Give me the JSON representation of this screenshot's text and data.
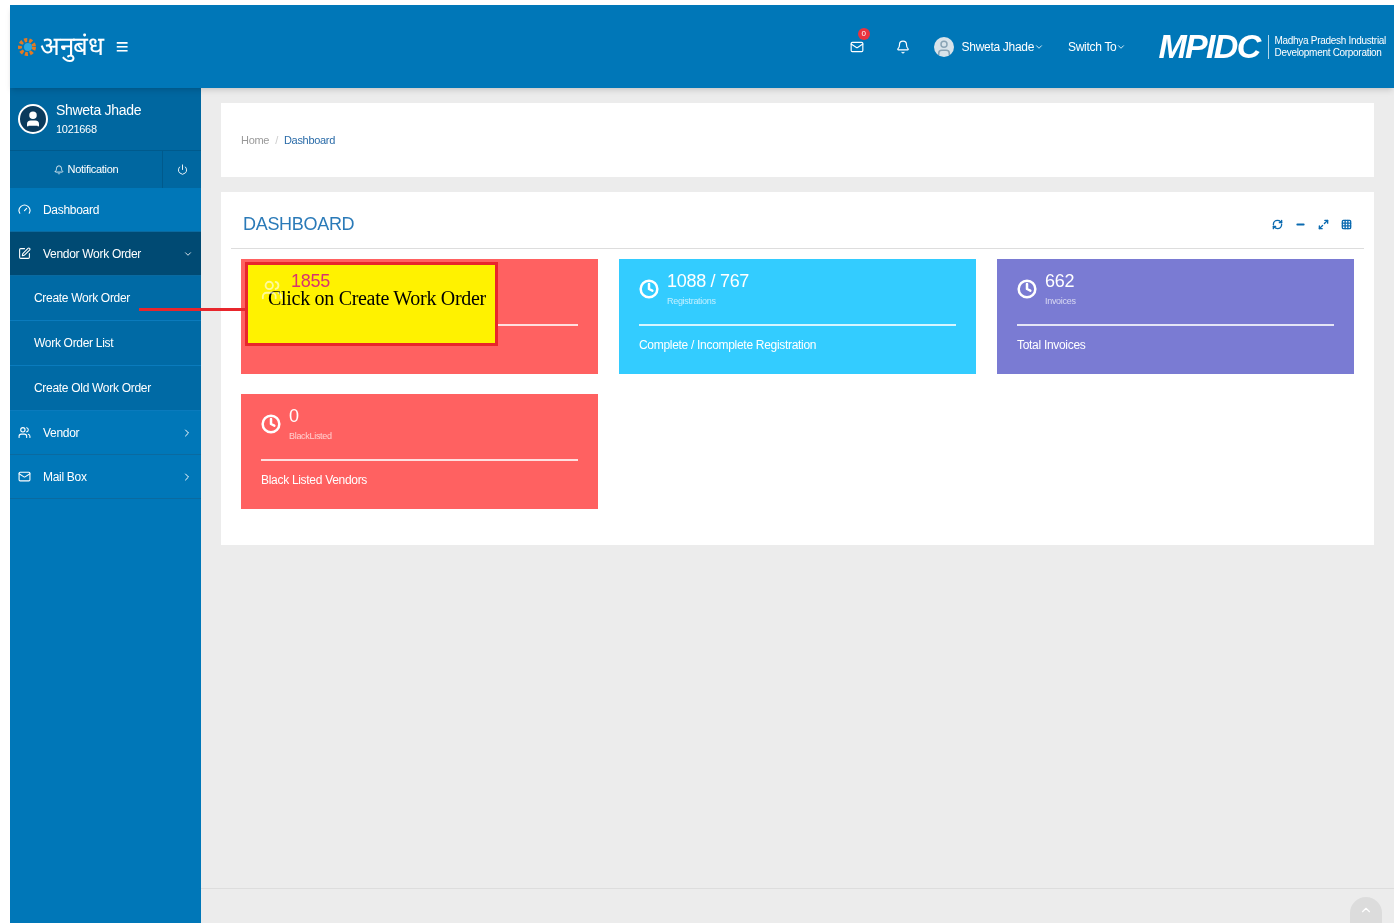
{
  "header": {
    "logo_text": "अनुबंध",
    "menu_glyph": "≡",
    "mail_count": "0",
    "user_name": "Shweta Jhade",
    "switch_label": "Switch To",
    "org_logo": "MPIDC",
    "org_name_line1": "Madhya Pradesh Industrial",
    "org_name_line2": "Development Corporation"
  },
  "profile": {
    "name": "Shweta Jhade",
    "id": "1021668",
    "notification_label": "Notification"
  },
  "sidebar": {
    "items": [
      {
        "label": "Dashboard",
        "selected": false
      },
      {
        "label": "Vendor Work Order",
        "expanded": true,
        "selected": true,
        "children": [
          {
            "label": "Create Work Order"
          },
          {
            "label": "Work Order List"
          },
          {
            "label": "Create Old Work Order"
          }
        ]
      },
      {
        "label": "Vendor",
        "expanded": false,
        "selected": false
      },
      {
        "label": "Mail Box",
        "expanded": false,
        "selected": false
      }
    ]
  },
  "breadcrumb": {
    "separator": "/",
    "items": [
      {
        "label": "Home",
        "selected": false
      },
      {
        "label": "Dashboard",
        "selected": true
      }
    ]
  },
  "panel": {
    "title": "DASHBOARD"
  },
  "cards": [
    {
      "value": "1855",
      "color": "#ff6161"
    },
    {
      "value": "1088 / 767",
      "label": "Registrations",
      "footer": "Complete / Incomplete Registration",
      "color": "#33ccff"
    },
    {
      "value": "662",
      "label": "Invoices",
      "footer": "Total Invoices",
      "color": "#7a7bd3"
    },
    {
      "value": "0",
      "label": "BlackListed",
      "footer": "Black Listed Vendors",
      "color": "#ff6161"
    }
  ],
  "callout": {
    "text": "Click on Create Work Order"
  }
}
